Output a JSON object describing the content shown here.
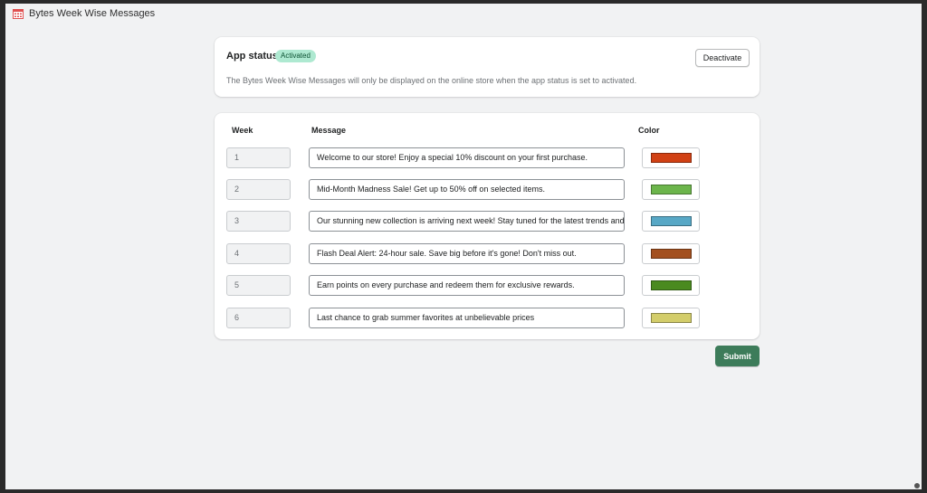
{
  "window": {
    "title": "Bytes Week Wise Messages",
    "app_icon": "calendar-grid-icon"
  },
  "status": {
    "title": "App status",
    "badge": "Activated",
    "description": "The Bytes Week Wise Messages will only be displayed on the online store when the app status is set to activated.",
    "deactivate_label": "Deactivate"
  },
  "table": {
    "headers": {
      "week": "Week",
      "message": "Message",
      "color": "Color"
    },
    "rows": [
      {
        "week": "1",
        "message": "Welcome to our store! Enjoy a special 10% discount on your first purchase.",
        "color": "#d14114"
      },
      {
        "week": "2",
        "message": "Mid-Month Madness Sale! Get up to 50% off on selected items.",
        "color": "#6cb54b"
      },
      {
        "week": "3",
        "message": "Our stunning new collection is arriving next week! Stay tuned for the latest trends and",
        "color": "#58a8c6"
      },
      {
        "week": "4",
        "message": "Flash Deal Alert: 24-hour sale. Save big before it's gone! Don't miss out.",
        "color": "#a3501f"
      },
      {
        "week": "5",
        "message": "Earn points on every purchase and redeem them for exclusive rewards.",
        "color": "#4a8a1f"
      },
      {
        "week": "6",
        "message": "Last chance to grab summer favorites at unbelievable prices",
        "color": "#d3cd6a"
      }
    ]
  },
  "submit_label": "Submit",
  "colors": {
    "accent": "#3d7c5a",
    "badge_bg": "#aee9d1"
  }
}
